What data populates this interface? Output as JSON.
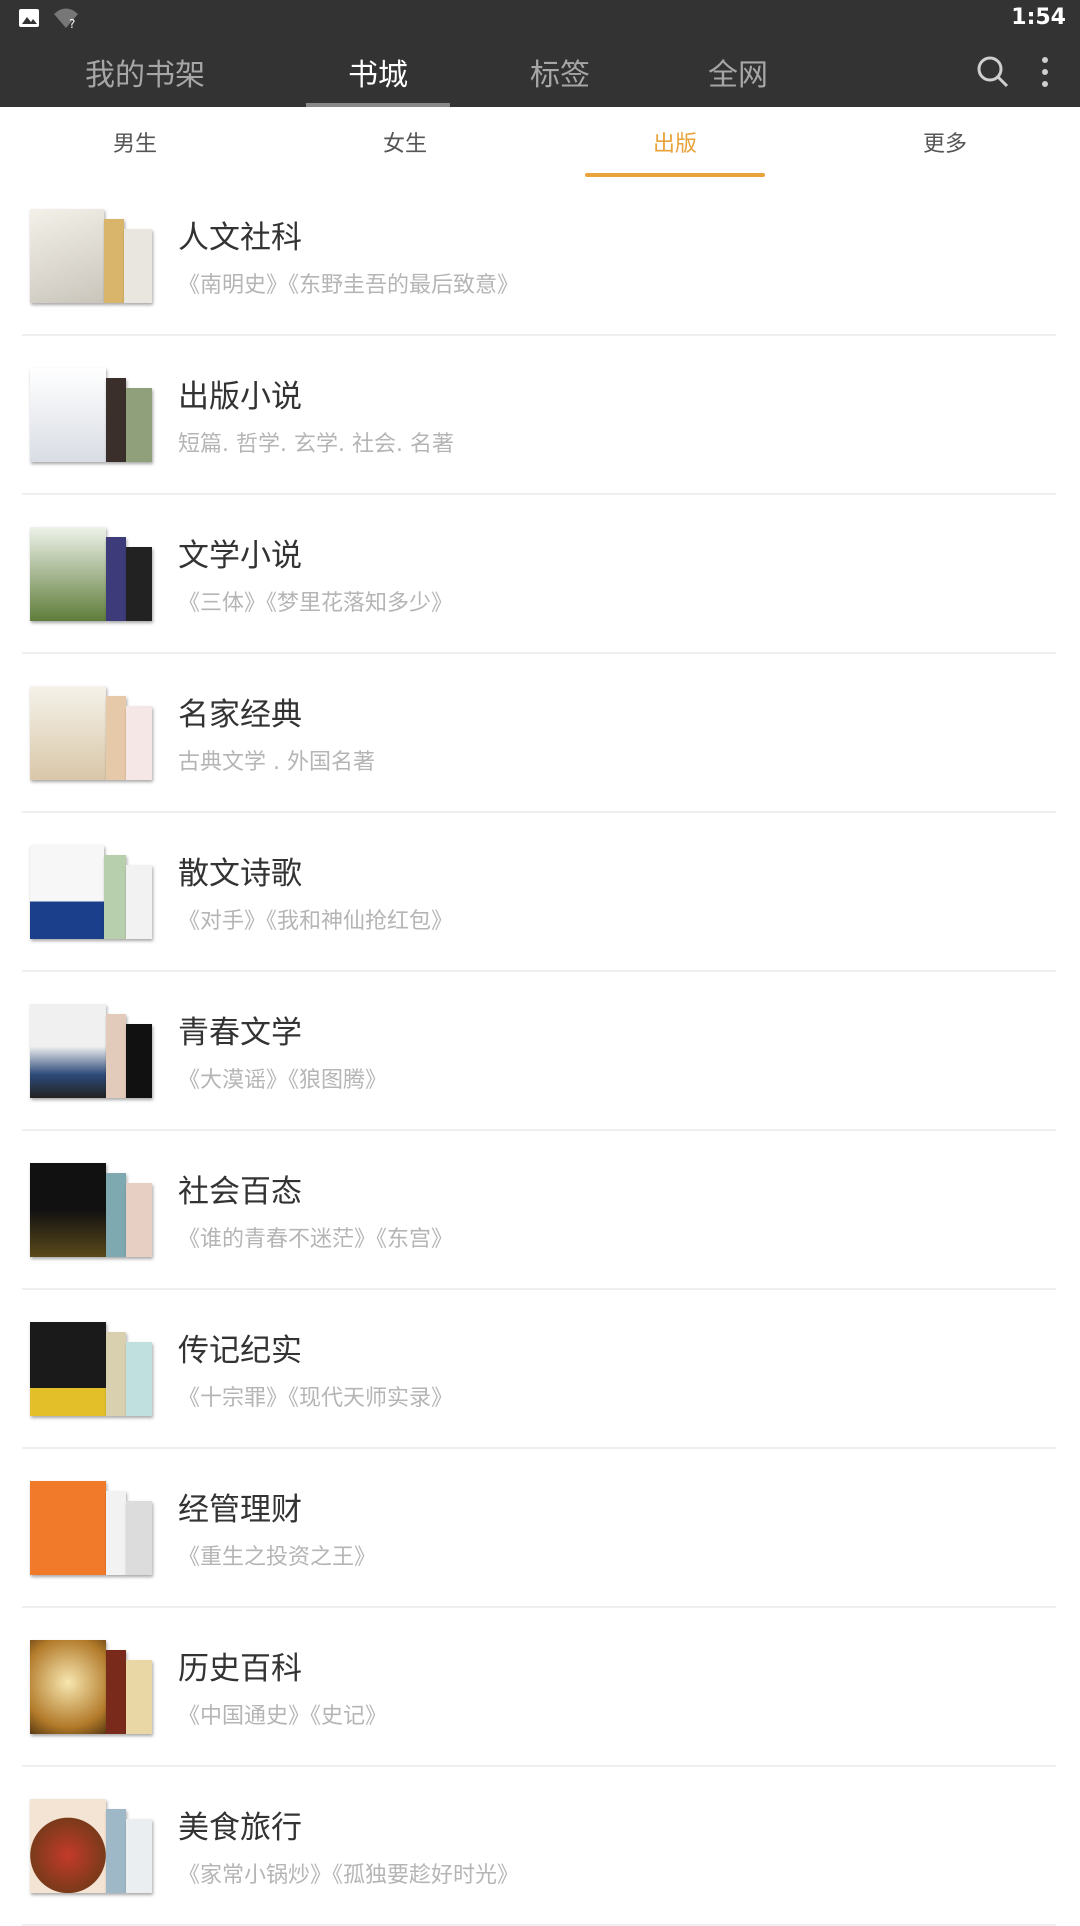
{
  "status": {
    "time": "1:54",
    "image_icon": "image-icon",
    "wifi_icon": "wifi-question-icon"
  },
  "top_tabs": [
    {
      "label": "我的书架",
      "active": false
    },
    {
      "label": "书城",
      "active": true
    },
    {
      "label": "标签",
      "active": false
    },
    {
      "label": "全网",
      "active": false
    }
  ],
  "top_icons": [
    "search-icon",
    "more-vert-icon"
  ],
  "sub_tabs": [
    {
      "label": "男生",
      "active": false
    },
    {
      "label": "女生",
      "active": false
    },
    {
      "label": "出版",
      "active": true
    },
    {
      "label": "更多",
      "active": false
    }
  ],
  "colors": {
    "bar": "#333333",
    "accent": "#e8a33b"
  },
  "categories": [
    {
      "title": "人文社科",
      "desc": "《南明史》《东野圭吾的最后致意》"
    },
    {
      "title": "出版小说",
      "desc": "短篇. 哲学. 玄学. 社会. 名著"
    },
    {
      "title": "文学小说",
      "desc": "《三体》《梦里花落知多少》"
    },
    {
      "title": "名家经典",
      "desc": "古典文学 . 外国名著"
    },
    {
      "title": "散文诗歌",
      "desc": "《对手》《我和神仙抢红包》"
    },
    {
      "title": "青春文学",
      "desc": "《大漠谣》《狼图腾》"
    },
    {
      "title": "社会百态",
      "desc": "《谁的青春不迷茫》《东宫》"
    },
    {
      "title": "传记纪实",
      "desc": "《十宗罪》《现代天师实录》"
    },
    {
      "title": "经管理财",
      "desc": "《重生之投资之王》"
    },
    {
      "title": "历史百科",
      "desc": "《中国通史》《史记》"
    },
    {
      "title": "美食旅行",
      "desc": "《家常小锅炒》《孤独要趁好时光》"
    }
  ]
}
